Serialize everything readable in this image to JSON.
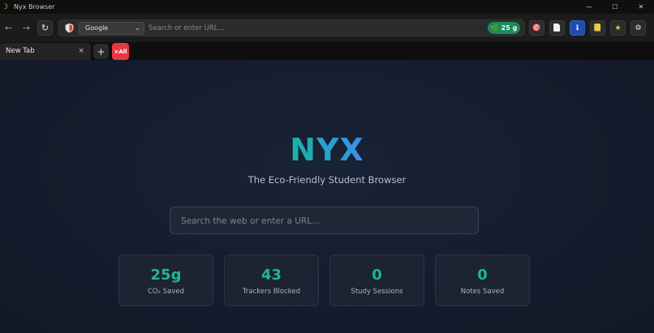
{
  "window": {
    "title": "Nyx Browser",
    "controls": [
      "—",
      "☐",
      "✕"
    ]
  },
  "toolbar": {
    "back_icon": "←",
    "forward_icon": "→",
    "refresh_icon": "↻",
    "search_engine": "Google",
    "url_placeholder": "Search or enter URL...",
    "co2_badge": "25 g",
    "tools": [
      {
        "name": "focus-target-icon",
        "glyph": "🎯"
      },
      {
        "name": "notes-icon",
        "glyph": "📄"
      },
      {
        "name": "info-icon",
        "glyph": "ℹ"
      },
      {
        "name": "book-icon",
        "glyph": "📒"
      },
      {
        "name": "star-icon",
        "glyph": "★"
      },
      {
        "name": "gear-icon",
        "glyph": "⚙"
      }
    ]
  },
  "tabs": {
    "items": [
      {
        "label": "New Tab",
        "close": "×"
      }
    ],
    "new_tab": "+",
    "close_all": "×All"
  },
  "home": {
    "logo": "NYX",
    "tagline": "The Eco-Friendly Student Browser",
    "search_placeholder": "Search the web or enter a URL...",
    "stats": [
      {
        "value": "25g",
        "label": "CO₂ Saved"
      },
      {
        "value": "43",
        "label": "Trackers Blocked"
      },
      {
        "value": "0",
        "label": "Study Sessions"
      },
      {
        "value": "0",
        "label": "Notes Saved"
      }
    ]
  },
  "colors": {
    "accent_green": "#1fb88a",
    "co2_pill": "#1c8a5a",
    "close_all_red": "#e5393f"
  }
}
